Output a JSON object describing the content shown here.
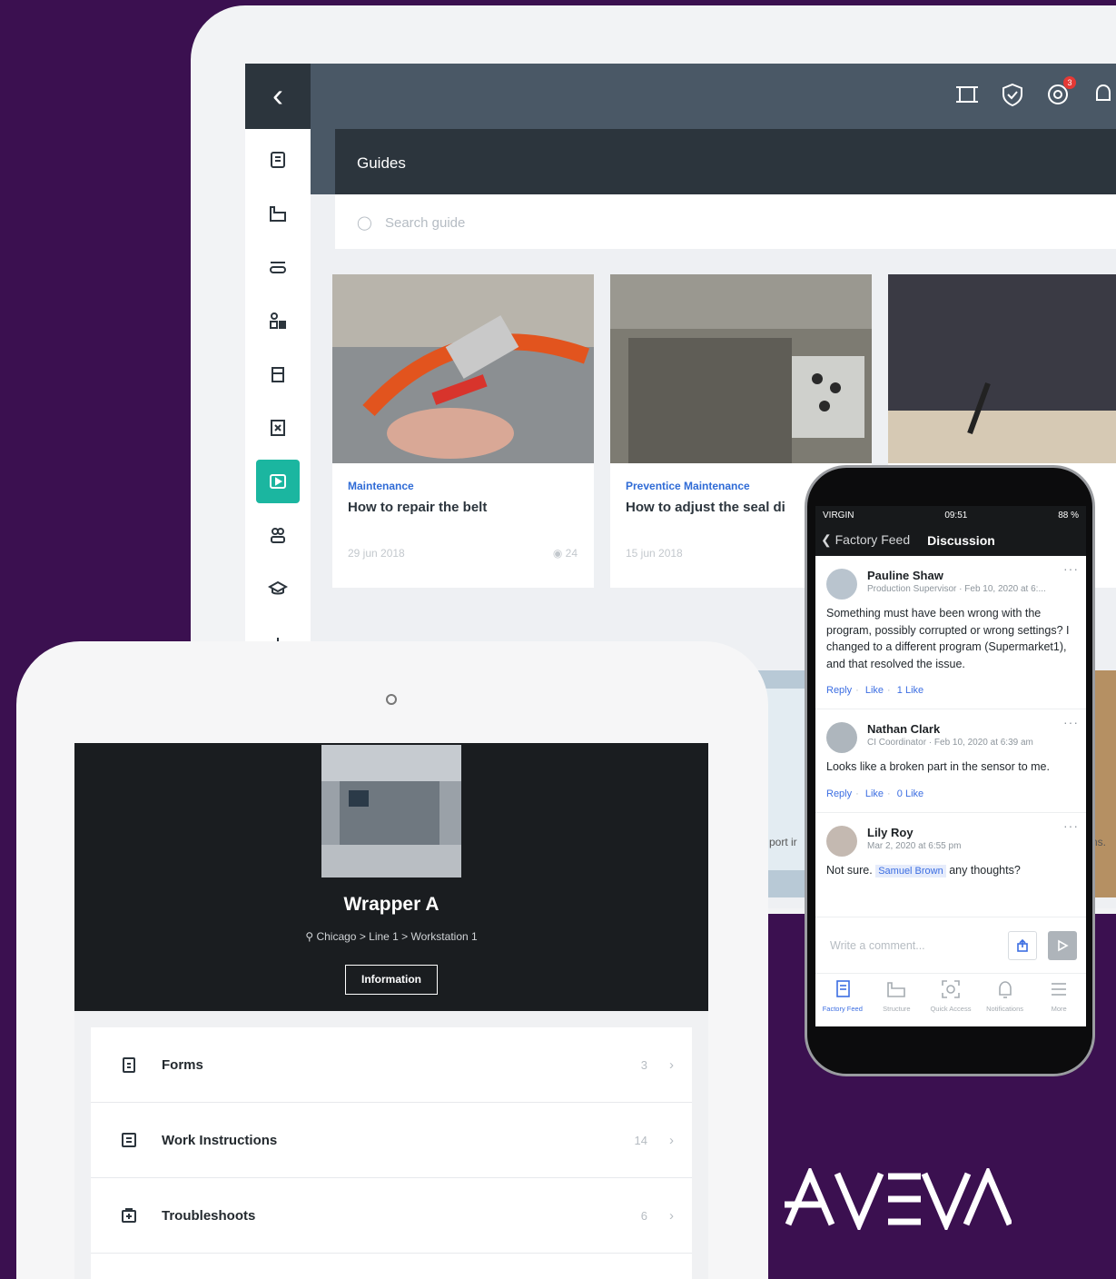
{
  "desktop": {
    "notification_count": "3",
    "guides_title": "Guides",
    "search_placeholder": "Search guide",
    "cards": [
      {
        "category": "Maintenance",
        "title": "How to repair the belt",
        "date": "29 jun 2018",
        "views": "24"
      },
      {
        "category": "Preventice Maintenance",
        "title": "How to adjust the seal di",
        "date": "15 jun 2018",
        "views": ""
      },
      {
        "category": "",
        "title": "",
        "date": "",
        "views": ""
      }
    ],
    "hidden_fragments": [
      "port ir",
      "ns."
    ]
  },
  "tablet": {
    "asset_name": "Wrapper A",
    "location": "Chicago > Line 1 > Workstation 1",
    "info_button": "Information",
    "list": [
      {
        "label": "Forms",
        "count": "3",
        "icon": "clipboard-icon"
      },
      {
        "label": "Work Instructions",
        "count": "14",
        "icon": "document-icon"
      },
      {
        "label": "Troubleshoots",
        "count": "6",
        "icon": "first-aid-icon"
      }
    ]
  },
  "phone": {
    "carrier": "VIRGIN",
    "time": "09:51",
    "battery": "88 %",
    "back_label": "Factory Feed",
    "title": "Discussion",
    "comments": [
      {
        "name": "Pauline Shaw",
        "meta": "Production Supervisor · Feb 10, 2020 at 6:...",
        "body": "Something must have been wrong with the program, possibly corrupted or wrong settings? I changed to a different program (Supermarket1), and that resolved the issue.",
        "reply": "Reply",
        "like": "Like",
        "likes": "1 Like"
      },
      {
        "name": "Nathan Clark",
        "meta": "CI Coordinator · Feb 10, 2020 at 6:39 am",
        "body": "Looks like a broken part in the sensor to me.",
        "reply": "Reply",
        "like": "Like",
        "likes": "0 Like"
      },
      {
        "name": "Lily Roy",
        "meta": "Mar 2, 2020 at 6:55 pm",
        "body_prefix": "Not sure.",
        "mention": "Samuel Brown",
        "body_suffix": "any thoughts?"
      }
    ],
    "compose_placeholder": "Write a comment...",
    "tabbar": [
      "Factory Feed",
      "Structure",
      "Quick Access",
      "Notifications",
      "More"
    ]
  },
  "brand": {
    "logo_text": "AVEVA",
    "accent": "#1bb6a0",
    "background": "#3b1050",
    "link_blue": "#3c6ee2"
  }
}
